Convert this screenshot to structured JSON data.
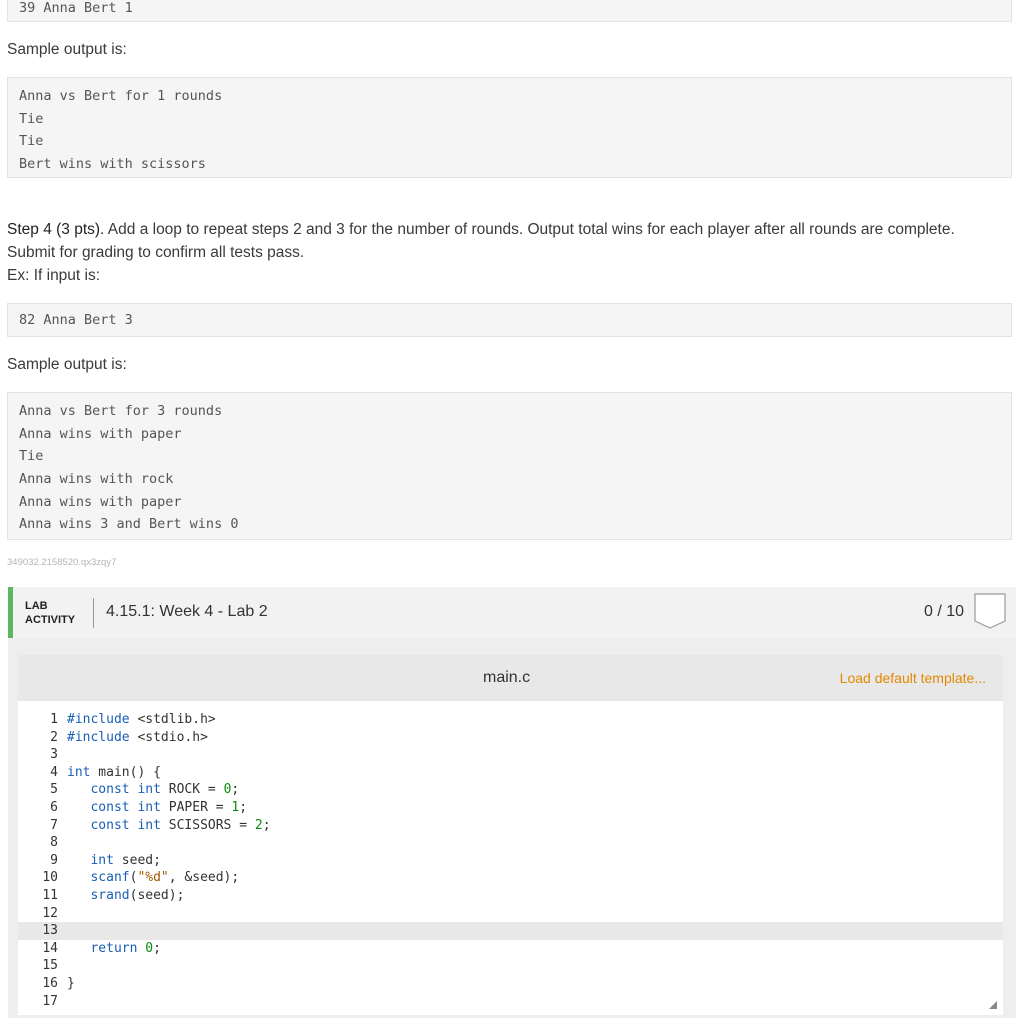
{
  "top_input": "39 Anna Bert 1",
  "step3": {
    "sample_label": "Sample output is:",
    "output_lines": [
      "Anna vs Bert for 1 rounds",
      "Tie",
      "Tie",
      "Bert wins with scissors"
    ]
  },
  "step4": {
    "heading": "Step 4 (3 pts).",
    "text1": " Add a loop to repeat steps 2 and 3 for the number of rounds. Output total wins for each player after all rounds are complete.",
    "text2": "Submit for grading to confirm all tests pass.",
    "text3": "Ex: If input is:",
    "input": "82 Anna Bert 3",
    "sample_label": "Sample output is:",
    "output_lines": [
      "Anna vs Bert for 3 rounds",
      "Anna wins with paper",
      "Tie",
      "Anna wins with rock",
      "Anna wins with paper",
      "Anna wins 3 and Bert wins 0"
    ]
  },
  "activity_id": "349032.2158520.qx3zqy7",
  "lab": {
    "tag_line1": "LAB",
    "tag_line2": "ACTIVITY",
    "title": "4.15.1: Week 4 - Lab 2",
    "score": "0 / 10",
    "accent_color": "#5cb85c"
  },
  "editor": {
    "filename": "main.c",
    "load_template": "Load default template...",
    "load_color": "#e28a00",
    "active_line": 13
  }
}
